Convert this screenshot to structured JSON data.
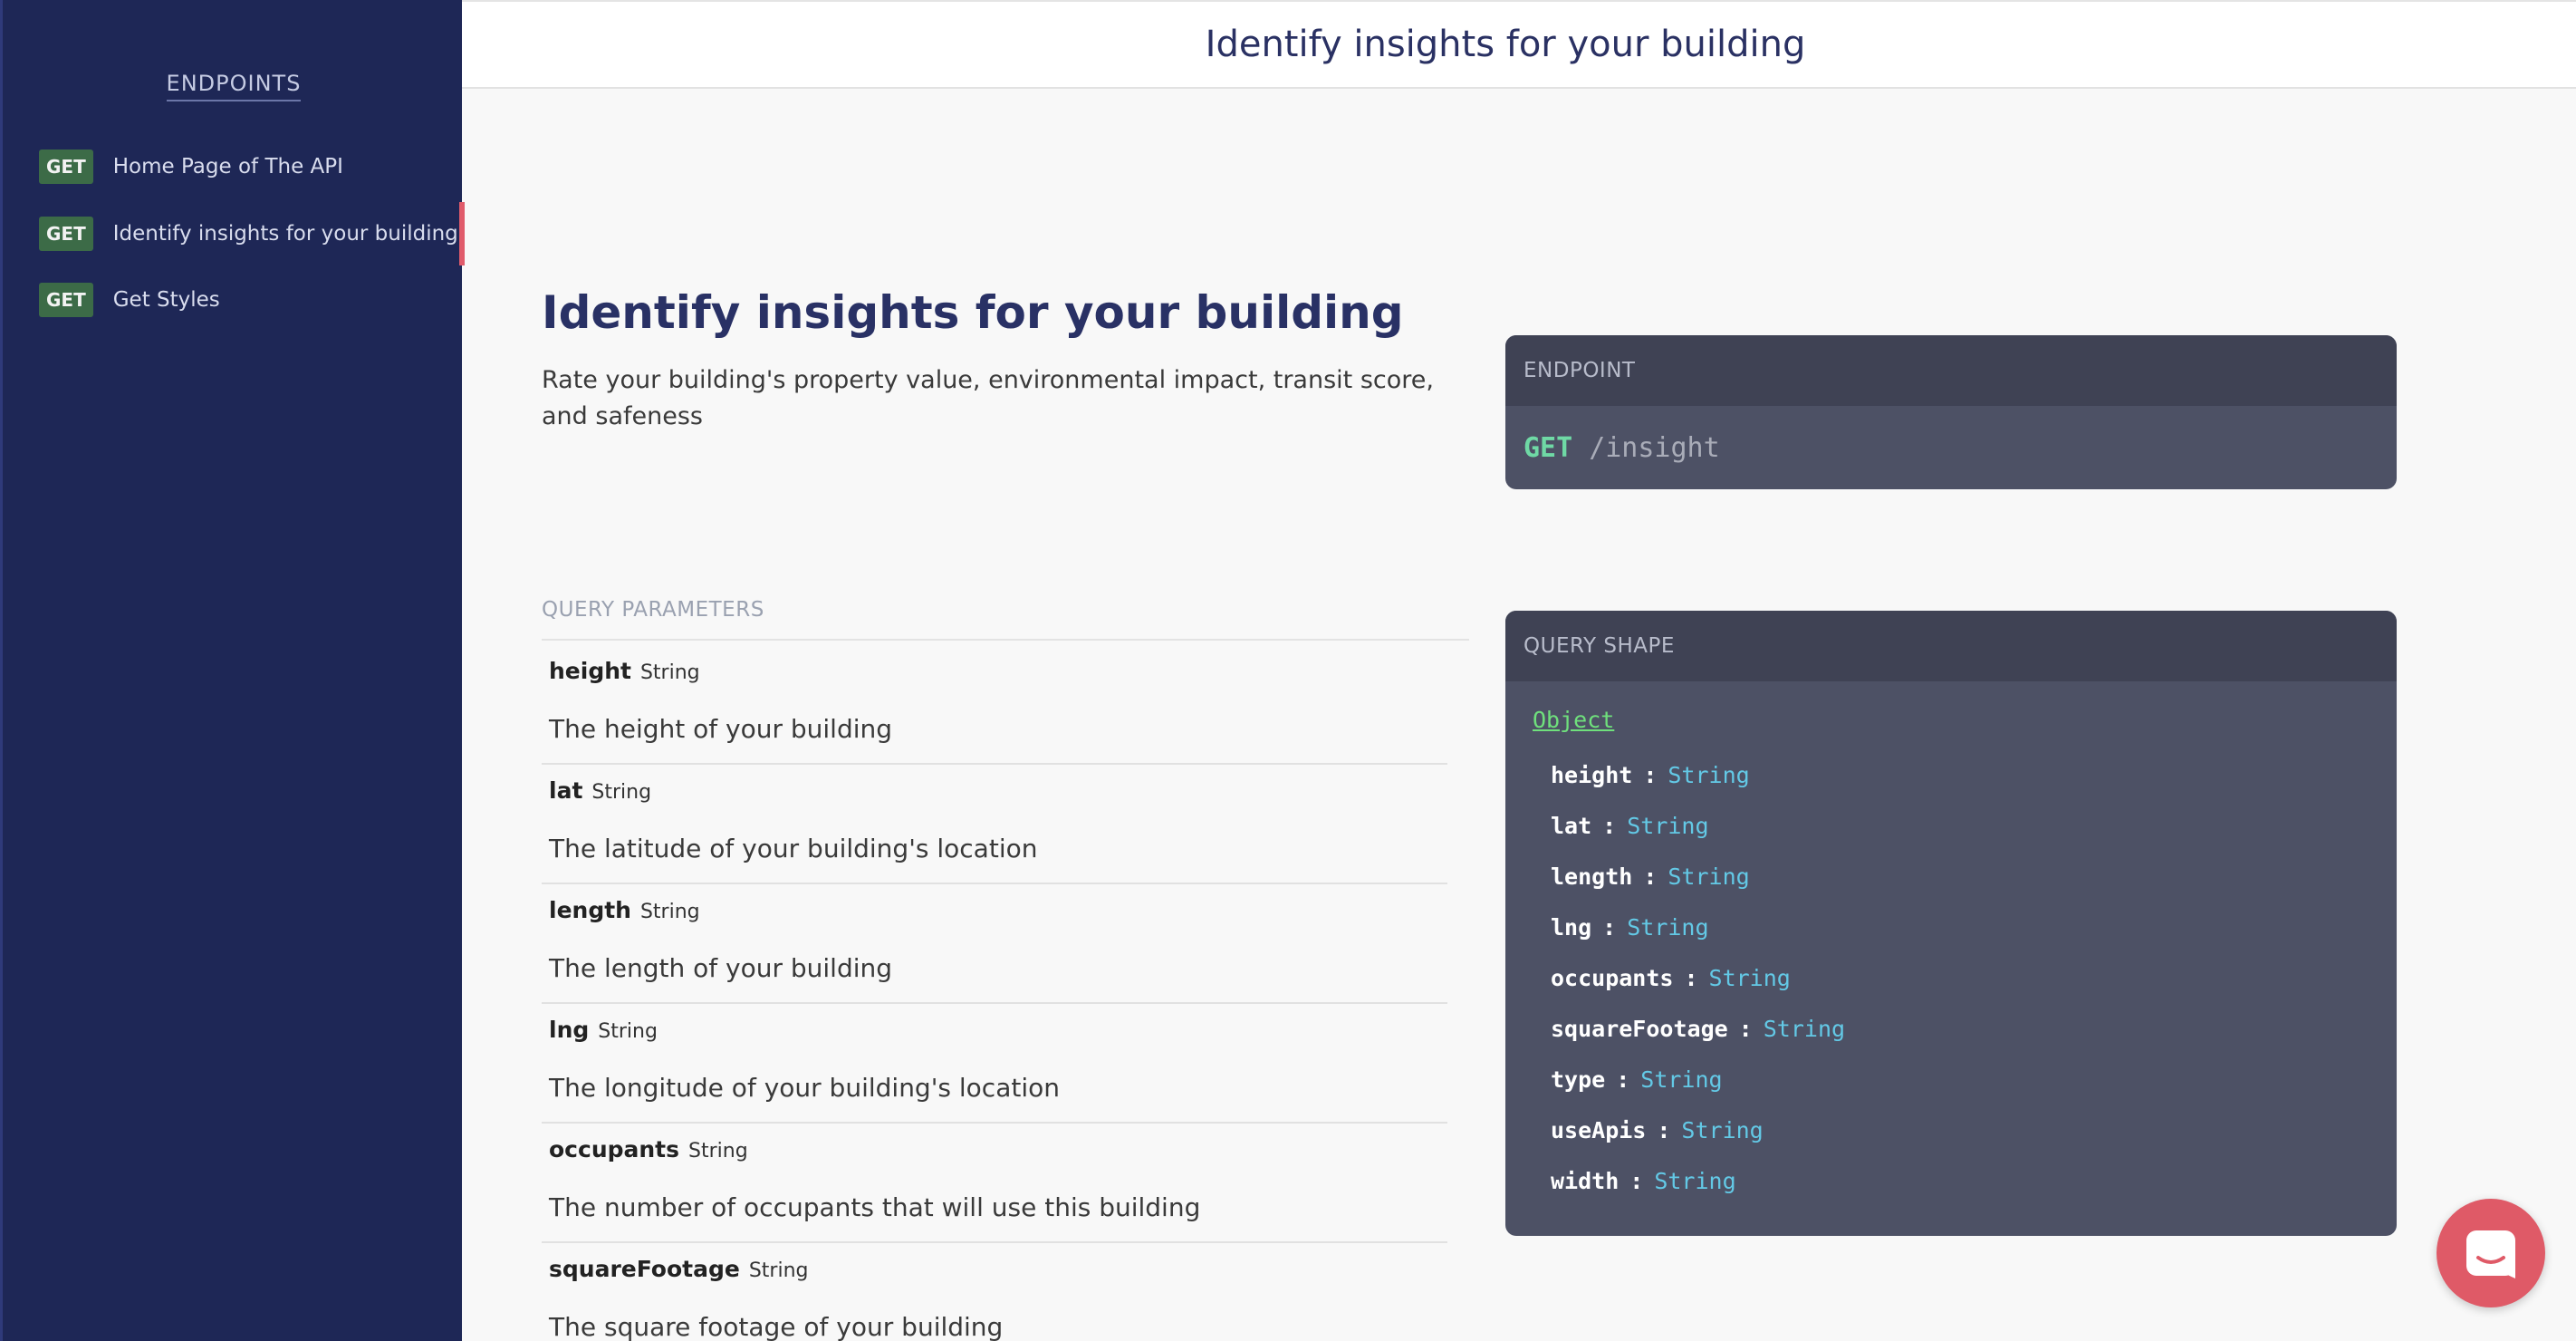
{
  "sidebar": {
    "heading": "ENDPOINTS",
    "items": [
      {
        "method": "GET",
        "label": "Home Page of The API",
        "active": false
      },
      {
        "method": "GET",
        "label": "Identify insights for your building",
        "active": true
      },
      {
        "method": "GET",
        "label": "Get Styles",
        "active": false
      }
    ]
  },
  "header": {
    "title": "Identify insights for your building"
  },
  "main": {
    "title": "Identify insights for your building",
    "description": "Rate your building's property value, environmental impact, transit score, and safeness",
    "query_params_label": "QUERY PARAMETERS",
    "params": [
      {
        "name": "height",
        "type": "String",
        "description": "The height of your building"
      },
      {
        "name": "lat",
        "type": "String",
        "description": "The latitude of your building's location"
      },
      {
        "name": "length",
        "type": "String",
        "description": "The length of your building"
      },
      {
        "name": "lng",
        "type": "String",
        "description": "The longitude of your building's location"
      },
      {
        "name": "occupants",
        "type": "String",
        "description": "The number of occupants that will use this building"
      },
      {
        "name": "squareFootage",
        "type": "String",
        "description": "The square footage of your building"
      }
    ]
  },
  "endpoint_panel": {
    "label": "ENDPOINT",
    "method": "GET",
    "path": "/insight"
  },
  "query_shape_panel": {
    "label": "QUERY SHAPE",
    "object_label": "Object",
    "fields": [
      {
        "name": "height",
        "type": "String"
      },
      {
        "name": "lat",
        "type": "String"
      },
      {
        "name": "length",
        "type": "String"
      },
      {
        "name": "lng",
        "type": "String"
      },
      {
        "name": "occupants",
        "type": "String"
      },
      {
        "name": "squareFootage",
        "type": "String"
      },
      {
        "name": "type",
        "type": "String"
      },
      {
        "name": "useApis",
        "type": "String"
      },
      {
        "name": "width",
        "type": "String"
      }
    ]
  },
  "colors": {
    "sidebar_bg": "#1e2756",
    "accent_active": "#e05b6b",
    "get_badge": "#3c6b47",
    "title": "#293165",
    "panel_bg": "#4d5165",
    "method_green": "#6fd9a5",
    "type_cyan": "#63c9e6",
    "chat_button": "#df5a67"
  },
  "chat": {
    "icon": "chat-icon"
  }
}
